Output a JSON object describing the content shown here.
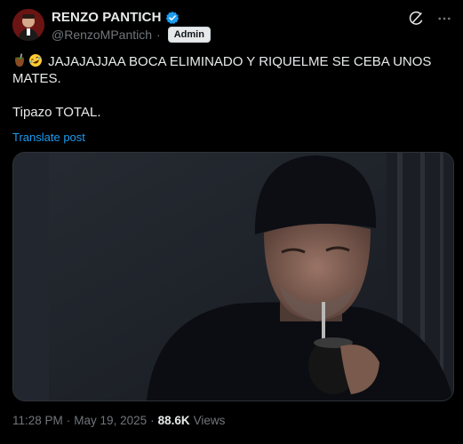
{
  "author": {
    "display_name": "RENZO PANTICH",
    "handle": "@RenzoMPantich",
    "separator": "·",
    "badge": "Admin"
  },
  "post": {
    "line1": "JAJAJAJJAA BOCA ELIMINADO Y RIQUELME SE CEBA UNOS",
    "line2": "MATES.",
    "line3": "Tipazo TOTAL.",
    "translate": "Translate post"
  },
  "meta": {
    "time": "11:28 PM",
    "dot": "·",
    "date": "May 19, 2025",
    "dot2": "·",
    "views_count": "88.6K",
    "views_label": "Views"
  },
  "colors": {
    "accent": "#1d9bf0",
    "background": "#000000",
    "text": "#e7e9ea",
    "muted": "#71767b"
  },
  "icons": [
    "verified-badge-icon",
    "grok-icon",
    "more-options-icon",
    "mate-emoji-icon",
    "rofl-emoji-icon"
  ]
}
